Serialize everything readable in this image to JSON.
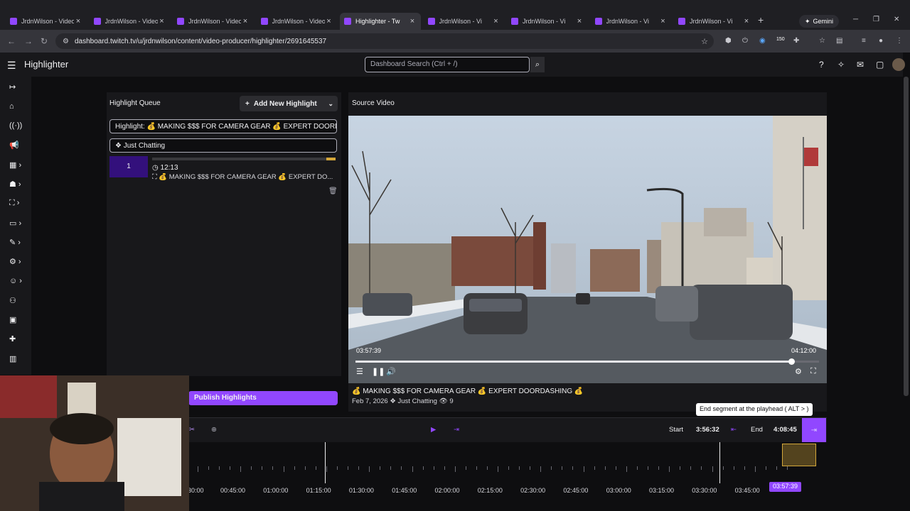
{
  "browser": {
    "tabs": [
      {
        "label": "JrdnWilson - Video",
        "active": false
      },
      {
        "label": "JrdnWilson - Video",
        "active": false
      },
      {
        "label": "JrdnWilson - Video",
        "active": false
      },
      {
        "label": "JrdnWilson - Video",
        "active": false
      },
      {
        "label": "Highlighter - Tw",
        "active": true
      },
      {
        "label": "JrdnWilson - Vi",
        "active": false
      },
      {
        "label": "JrdnWilson - Vi",
        "active": false
      },
      {
        "label": "JrdnWilson - Vi",
        "active": false
      },
      {
        "label": "JrdnWilson - Vi",
        "active": false
      }
    ],
    "new_tab": "+",
    "gemini_label": "Gemini",
    "url": "dashboard.twitch.tv/u/jrdnwilson/content/video-producer/highlighter/2691645537",
    "extension_badge": "150"
  },
  "header": {
    "title": "Highlighter",
    "search_placeholder": "Dashboard Search (Ctrl + /)"
  },
  "queue": {
    "heading": "Highlight Queue",
    "add_button": "Add New Highlight",
    "highlight_title": "Highlight: 💰 MAKING $$$ FOR CAMERA GEAR 💰 EXPERT DOORDASHING",
    "category": "Just Chatting",
    "clips": [
      {
        "index": "1",
        "duration": "12:13",
        "title": "💰 MAKING $$$ FOR CAMERA GEAR 💰 EXPERT DO...",
        "progress": 0.05
      }
    ],
    "publish_button": "Publish Highlights"
  },
  "source": {
    "heading": "Source Video",
    "current_time": "03:57:39",
    "end_time": "04:12:00",
    "progress": 0.94,
    "video_title": "💰 MAKING $$$ FOR CAMERA GEAR 💰 EXPERT DOORDASHING 💰",
    "date": "Feb 7, 2026",
    "category": "Just Chatting",
    "views": "9"
  },
  "timeline": {
    "start_label": "Start",
    "start_value": "3:56:32",
    "end_label": "End",
    "end_value": "4:08:45",
    "tooltip": "End segment at the playhead ( ALT > )",
    "ticks": [
      "30:00",
      "00:45:00",
      "01:00:00",
      "01:15:00",
      "01:30:00",
      "01:45:00",
      "02:00:00",
      "02:15:00",
      "02:30:00",
      "02:45:00",
      "03:00:00",
      "03:15:00",
      "03:30:00",
      "03:45:00"
    ],
    "playhead": "03:57:39"
  },
  "colors": {
    "accent": "#9147ff",
    "queue_item": "#33107c",
    "segment": "#d4a73a"
  }
}
